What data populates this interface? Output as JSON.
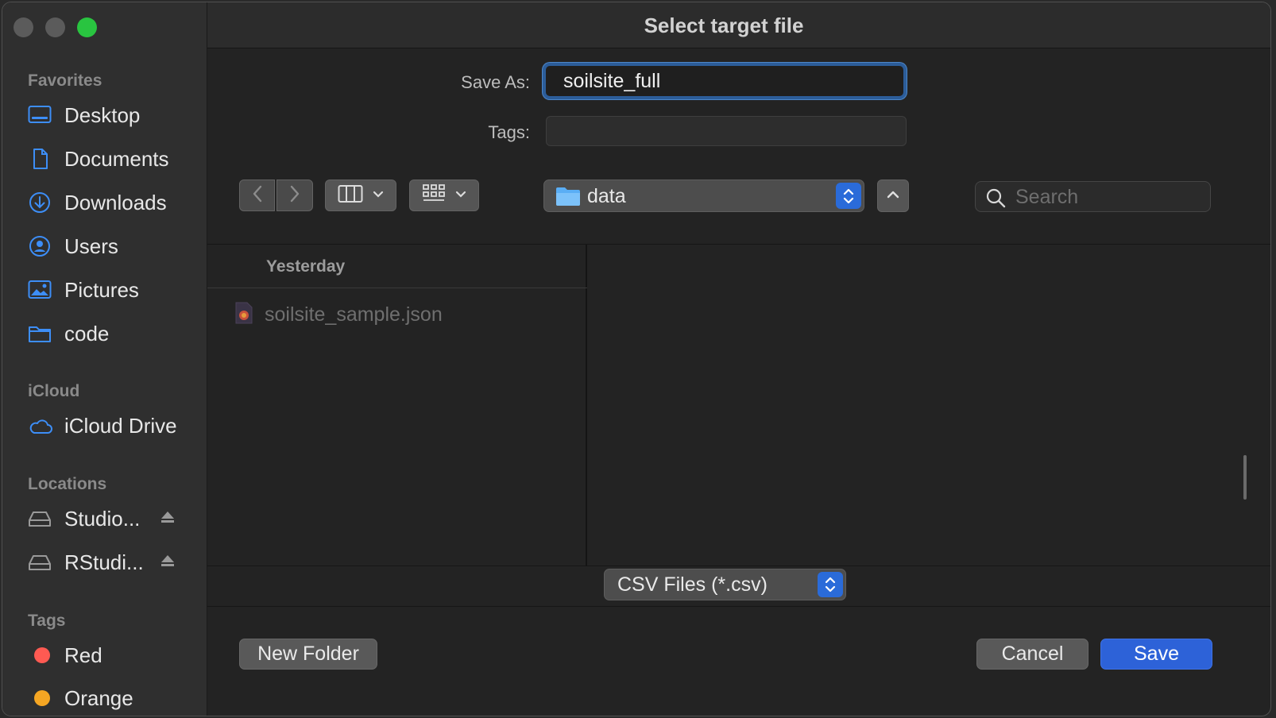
{
  "window": {
    "title": "Select target file"
  },
  "sidebar": {
    "favorites_heading": "Favorites",
    "favorites": [
      {
        "label": "Desktop",
        "icon": "desktop-icon"
      },
      {
        "label": "Documents",
        "icon": "document-icon"
      },
      {
        "label": "Downloads",
        "icon": "download-icon"
      },
      {
        "label": "Users",
        "icon": "user-icon"
      },
      {
        "label": "Pictures",
        "icon": "picture-icon"
      },
      {
        "label": "code",
        "icon": "folder-icon"
      }
    ],
    "icloud_heading": "iCloud",
    "icloud": [
      {
        "label": "iCloud Drive",
        "icon": "cloud-icon"
      }
    ],
    "locations_heading": "Locations",
    "locations": [
      {
        "label": "Studio...",
        "icon": "drive-icon"
      },
      {
        "label": "RStudi...",
        "icon": "drive-icon"
      }
    ],
    "tags_heading": "Tags",
    "tags": [
      {
        "label": "Red",
        "color": "#ff5a52"
      },
      {
        "label": "Orange",
        "color": "#f5a623"
      }
    ]
  },
  "form": {
    "save_as_label": "Save As:",
    "save_as_value": "soilsite_full",
    "tags_label": "Tags:"
  },
  "toolbar": {
    "current_folder": "data",
    "search_placeholder": "Search"
  },
  "browser": {
    "group_header": "Yesterday",
    "files": [
      {
        "name": "soilsite_sample.json",
        "enabled": false
      }
    ]
  },
  "format": {
    "selected": "CSV Files (*.csv)"
  },
  "footer": {
    "new_folder_label": "New Folder",
    "cancel_label": "Cancel",
    "save_label": "Save"
  },
  "colors": {
    "accent": "#2d62d8",
    "sidebar_icon": "#3d8ef7",
    "focus_ring": "#2c5d9a"
  }
}
